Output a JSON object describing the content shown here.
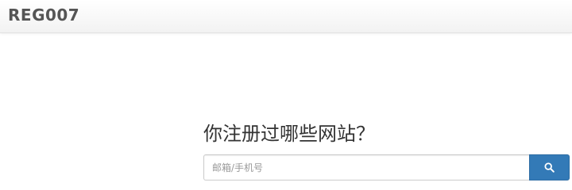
{
  "header": {
    "brand": "REG007"
  },
  "main": {
    "question": "你注册过哪些网站？",
    "search": {
      "placeholder": "邮箱/手机号",
      "value": "",
      "button_icon": "search-icon"
    }
  },
  "colors": {
    "accent": "#337ab7",
    "brand_text": "#555555",
    "heading_text": "#333333"
  }
}
